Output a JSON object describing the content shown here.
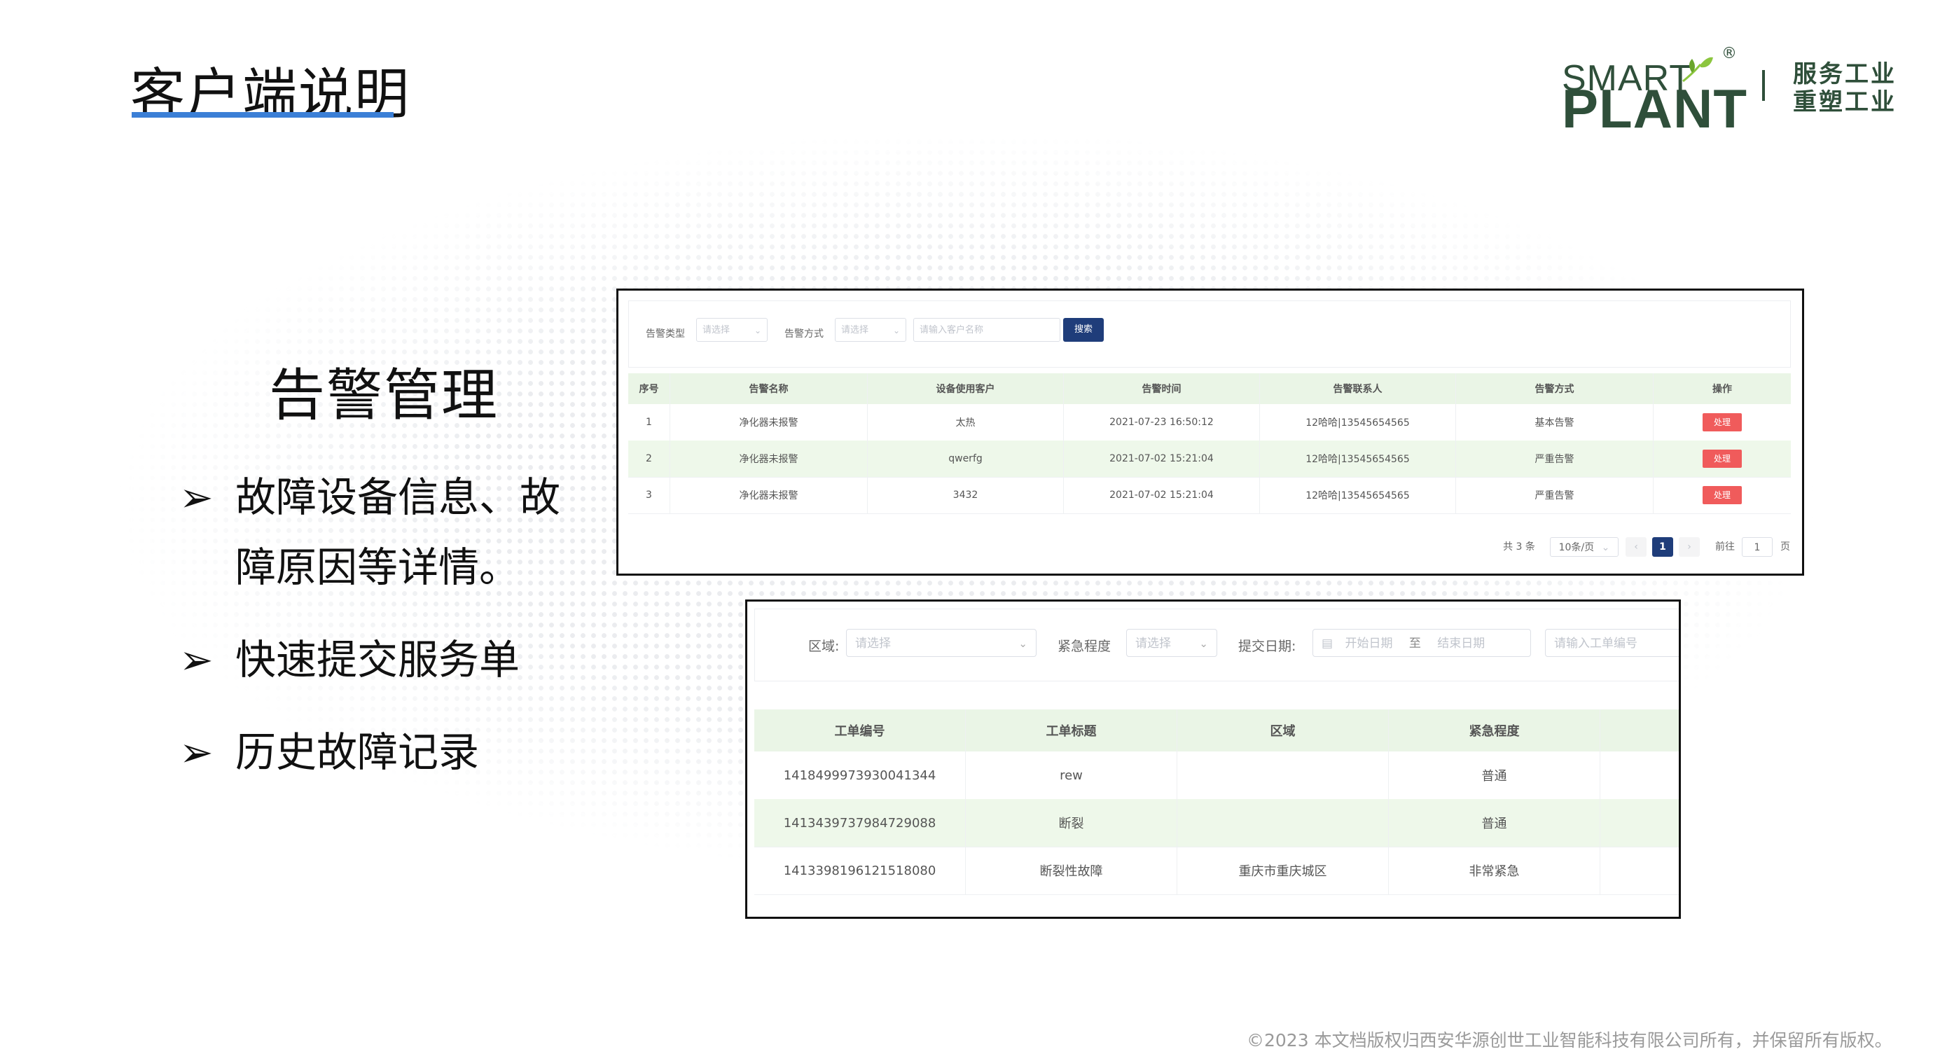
{
  "slide": {
    "title": "客户端说明",
    "section_heading": "告警管理",
    "bullets": [
      "故障设备信息、故",
      "障原因等详情。",
      "快速提交服务单",
      "历史故障记录"
    ],
    "bullet_symbol": "➢",
    "footer": "©2023 本文档版权归西安华源创世工业智能科技有限公司所有，并保留所有版权。",
    "accent_color": "#3b7fd6"
  },
  "logo": {
    "smart": "SMART",
    "plant": "PLANT",
    "registered": "®",
    "slogan_line1": "服务工业",
    "slogan_line2": "重塑工业",
    "brand_color": "#2f4f3a",
    "leaf_color": "#8cc63f"
  },
  "alarm_panel": {
    "filters": {
      "alarm_type_label": "告警类型",
      "alarm_type_placeholder": "请选择",
      "alarm_method_label": "告警方式",
      "alarm_method_placeholder": "请选择",
      "customer_placeholder": "请输入客户名称",
      "search_label": "搜索"
    },
    "columns": [
      "序号",
      "告警名称",
      "设备使用客户",
      "告警时间",
      "告警联系人",
      "告警方式",
      "操作"
    ],
    "rows": [
      {
        "no": "1",
        "name": "净化器未报警",
        "customer": "太热",
        "time": "2021-07-23 16:50:12",
        "contact": "12哈哈|13545654565",
        "method": "基本告警",
        "action": "处理"
      },
      {
        "no": "2",
        "name": "净化器未报警",
        "customer": "qwerfg",
        "time": "2021-07-02 15:21:04",
        "contact": "12哈哈|13545654565",
        "method": "严重告警",
        "action": "处理"
      },
      {
        "no": "3",
        "name": "净化器未报警",
        "customer": "3432",
        "time": "2021-07-02 15:21:04",
        "contact": "12哈哈|13545654565",
        "method": "严重告警",
        "action": "处理"
      }
    ],
    "pager": {
      "total": "共 3 条",
      "page_size": "10条/页",
      "prev": "‹",
      "current": "1",
      "next": "›",
      "goto_label": "前往",
      "goto_value": "1",
      "page_unit": "页"
    },
    "colors": {
      "header_bg": "#eaf5e6",
      "action_red": "#f05b5b",
      "primary": "#1f3d7a"
    }
  },
  "order_panel": {
    "filters": {
      "region_label": "区域:",
      "region_placeholder": "请选择",
      "urgency_label": "紧急程度",
      "urgency_placeholder": "请选择",
      "date_label": "提交日期:",
      "start_placeholder": "开始日期",
      "to": "至",
      "end_placeholder": "结束日期",
      "order_no_placeholder": "请输入工单编号"
    },
    "columns": [
      "工单编号",
      "工单标题",
      "区域",
      "紧急程度"
    ],
    "rows": [
      {
        "order_no": "1418499973930041344",
        "title": "rew",
        "region": "",
        "urgency": "普通"
      },
      {
        "order_no": "1413439737984729088",
        "title": "断裂",
        "region": "",
        "urgency": "普通"
      },
      {
        "order_no": "1413398196121518080",
        "title": "断裂性故障",
        "region": "重庆市重庆城区",
        "urgency": "非常紧急"
      }
    ]
  }
}
